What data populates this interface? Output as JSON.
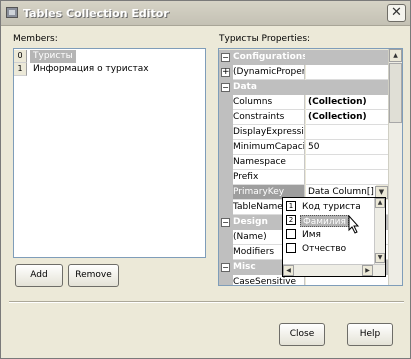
{
  "window": {
    "title": "Tables Collection Editor",
    "close_label": "✕"
  },
  "members": {
    "label": "Members:",
    "items": [
      {
        "index": "0",
        "text": "Туристы",
        "selected": true
      },
      {
        "index": "1",
        "text": "Информация о туристах",
        "selected": false
      }
    ],
    "add_label": "Add",
    "remove_label": "Remove"
  },
  "properties": {
    "label": "Туристы Properties:",
    "rows": [
      {
        "kind": "cat",
        "toggle": "−",
        "name": "Configurations"
      },
      {
        "kind": "prop",
        "toggle": "+",
        "name": "(DynamicPropert",
        "value": ""
      },
      {
        "kind": "cat",
        "toggle": "−",
        "name": "Data"
      },
      {
        "kind": "prop",
        "name": "Columns",
        "value": "(Collection)",
        "bold": true
      },
      {
        "kind": "prop",
        "name": "Constraints",
        "value": "(Collection)",
        "bold": true
      },
      {
        "kind": "prop",
        "name": "DisplayExpressio",
        "value": ""
      },
      {
        "kind": "prop",
        "name": "MinimumCapacity",
        "value": "50"
      },
      {
        "kind": "prop",
        "name": "Namespace",
        "value": ""
      },
      {
        "kind": "prop",
        "name": "Prefix",
        "value": ""
      },
      {
        "kind": "prop",
        "name": "PrimaryKey",
        "value": "Data Column[]",
        "selected": true
      },
      {
        "kind": "prop",
        "name": "TableName",
        "value": ""
      },
      {
        "kind": "cat",
        "toggle": "−",
        "name": "Design"
      },
      {
        "kind": "prop",
        "name": "(Name)",
        "value": ""
      },
      {
        "kind": "prop",
        "name": "Modifiers",
        "value": ""
      },
      {
        "kind": "cat",
        "toggle": "−",
        "name": "Misc"
      },
      {
        "kind": "prop",
        "name": "CaseSensitive",
        "value": ""
      }
    ]
  },
  "primary_key_dropdown": {
    "items": [
      {
        "index": "1",
        "text": "Код туриста",
        "selected": false
      },
      {
        "index": "2",
        "text": "Фамилия",
        "selected": true
      },
      {
        "index": "",
        "text": "Имя",
        "selected": false
      },
      {
        "index": "",
        "text": "Отчество",
        "selected": false
      }
    ]
  },
  "footer": {
    "close_label": "Close",
    "help_label": "Help"
  }
}
